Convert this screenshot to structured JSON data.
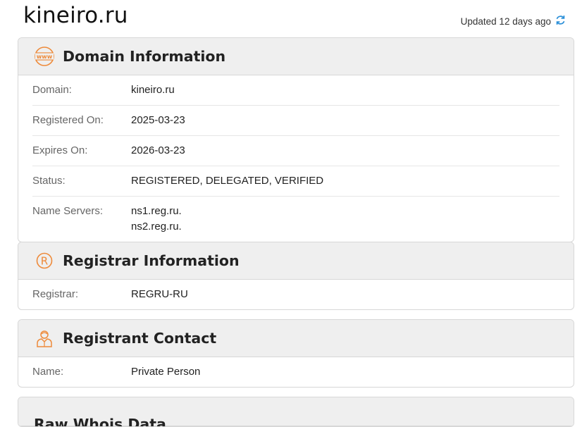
{
  "header": {
    "domain": "kineiro.ru",
    "updated": "Updated 12 days ago"
  },
  "icons": {
    "refresh": "refresh-icon",
    "www": "www-globe-icon",
    "registered": "registered-trademark-icon",
    "person": "person-contact-icon"
  },
  "colors": {
    "accent_orange": "#ee8a3a",
    "refresh_blue": "#2a8fd8"
  },
  "domain_info": {
    "title": "Domain Information",
    "rows": [
      {
        "label": "Domain:",
        "value": "kineiro.ru"
      },
      {
        "label": "Registered On:",
        "value": "2025-03-23"
      },
      {
        "label": "Expires On:",
        "value": "2026-03-23"
      },
      {
        "label": "Status:",
        "value": "REGISTERED, DELEGATED, VERIFIED"
      },
      {
        "label": "Name Servers:",
        "values": [
          "ns1.reg.ru.",
          "ns2.reg.ru."
        ]
      }
    ]
  },
  "registrar_info": {
    "title": "Registrar Information",
    "rows": [
      {
        "label": "Registrar:",
        "value": "REGRU-RU"
      }
    ]
  },
  "registrant_contact": {
    "title": "Registrant Contact",
    "rows": [
      {
        "label": "Name:",
        "value": "Private Person"
      }
    ]
  },
  "raw_whois": {
    "title": "Raw Whois Data"
  }
}
